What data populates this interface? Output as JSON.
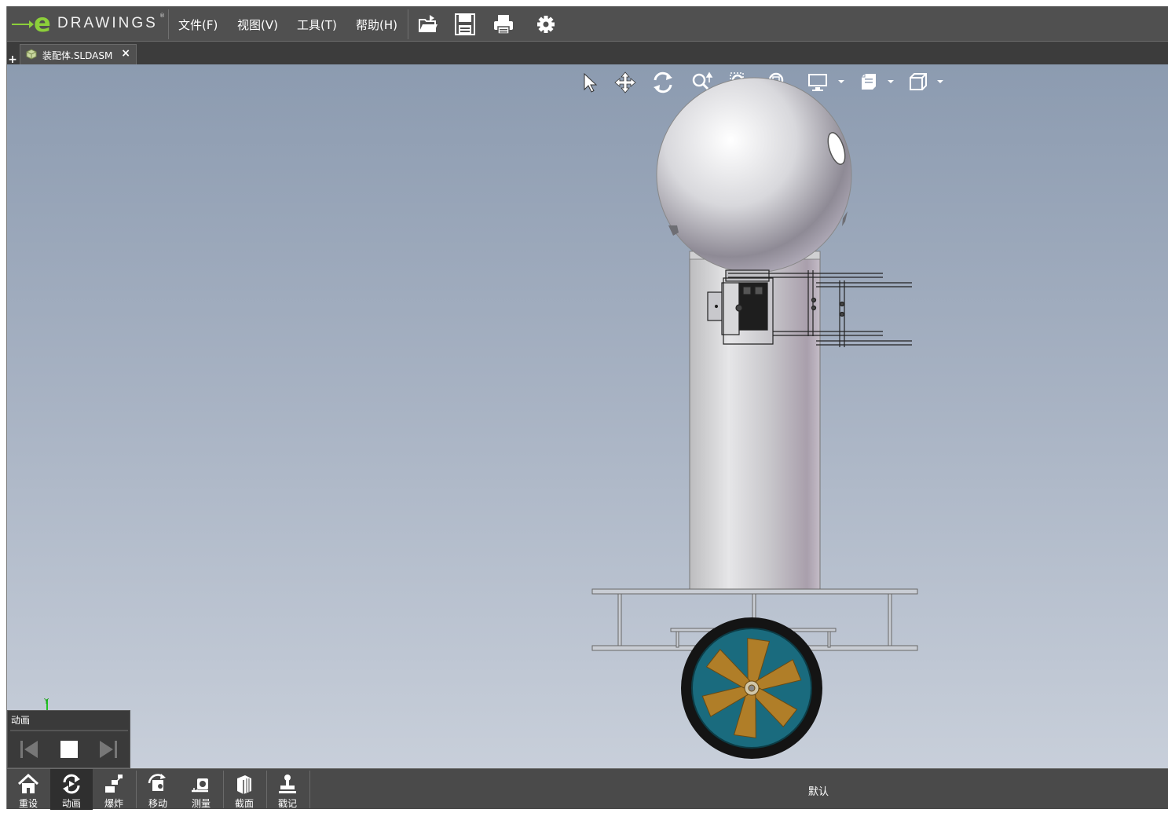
{
  "app": {
    "logo_text": "DRAWINGS",
    "logo_letter": "e",
    "logo_reg": "®"
  },
  "menu": {
    "file": "文件(F)",
    "view": "视图(V)",
    "tools": "工具(T)",
    "help": "帮助(H)"
  },
  "toolbar": {
    "open_icon": "open-folder-icon",
    "save_icon": "save-icon",
    "print_icon": "print-icon",
    "settings_icon": "gear-icon"
  },
  "tabs": {
    "new_tab_label": "+",
    "document_tab_label": "装配体.SLDASM",
    "close_label": "×"
  },
  "view_tools": [
    {
      "name": "select-icon"
    },
    {
      "name": "pan-icon"
    },
    {
      "name": "rotate-icon"
    },
    {
      "name": "zoom-icon"
    },
    {
      "name": "zoom-to-area-icon"
    },
    {
      "name": "zoom-to-fit-icon"
    },
    {
      "name": "display-style-icon"
    },
    {
      "name": "sheet-view-icon"
    },
    {
      "name": "view-orientation-icon"
    }
  ],
  "triad": {
    "y_label": "Y"
  },
  "animation_panel": {
    "title": "动画"
  },
  "bottom_toolbar": {
    "items": [
      {
        "label": "重设",
        "icon": "home-icon"
      },
      {
        "label": "动画",
        "icon": "animate-icon"
      },
      {
        "label": "爆炸",
        "icon": "explode-icon"
      },
      {
        "label": "移动",
        "icon": "move-icon"
      },
      {
        "label": "测量",
        "icon": "measure-icon"
      },
      {
        "label": "截面",
        "icon": "section-icon"
      },
      {
        "label": "戳记",
        "icon": "stamp-icon"
      }
    ],
    "configuration": "默认"
  },
  "colors": {
    "menubar": "#505050",
    "accent_green": "#8ccf3a",
    "wheel_teal": "#1a6b7e",
    "wheel_spokes": "#b07e28"
  }
}
